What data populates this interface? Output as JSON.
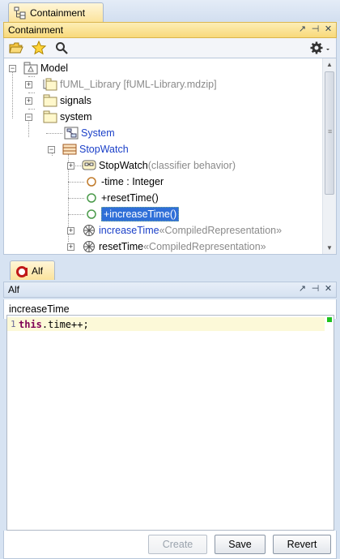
{
  "top_tab": {
    "label": "Containment"
  },
  "containment_panel": {
    "title": "Containment",
    "title_buttons": [
      "↗",
      "⊣",
      "✕"
    ]
  },
  "tree": {
    "items": [
      {
        "label": "Model",
        "extra": ""
      },
      {
        "label": "fUML_Library [fUML-Library.mdzip]",
        "extra": ""
      },
      {
        "label": "signals",
        "extra": ""
      },
      {
        "label": "system",
        "extra": ""
      },
      {
        "label": "System",
        "extra": ""
      },
      {
        "label": "StopWatch",
        "extra": ""
      },
      {
        "label": "StopWatch",
        "extra": "(classifier behavior)"
      },
      {
        "label": "-time : Integer",
        "extra": ""
      },
      {
        "label": "+resetTime()",
        "extra": ""
      },
      {
        "label": "+increaseTime()",
        "extra": ""
      },
      {
        "label": "increaseTime",
        "extra": " «CompiledRepresentation»"
      },
      {
        "label": "resetTime",
        "extra": " «CompiledRepresentation»"
      }
    ]
  },
  "alf_tab": {
    "label": "Alf"
  },
  "alf_panel": {
    "title": "Alf",
    "title_buttons": [
      "↗",
      "⊣",
      "✕"
    ],
    "element_name": "increaseTime",
    "code": {
      "line_number": "1",
      "keyword": "this",
      "rest": ".time++;"
    }
  },
  "buttons": {
    "create": "Create",
    "save": "Save",
    "revert": "Revert"
  },
  "colors": {
    "accent_active": "#f8d97a",
    "selection": "#2f6fd8",
    "link": "#1a3fc8"
  }
}
